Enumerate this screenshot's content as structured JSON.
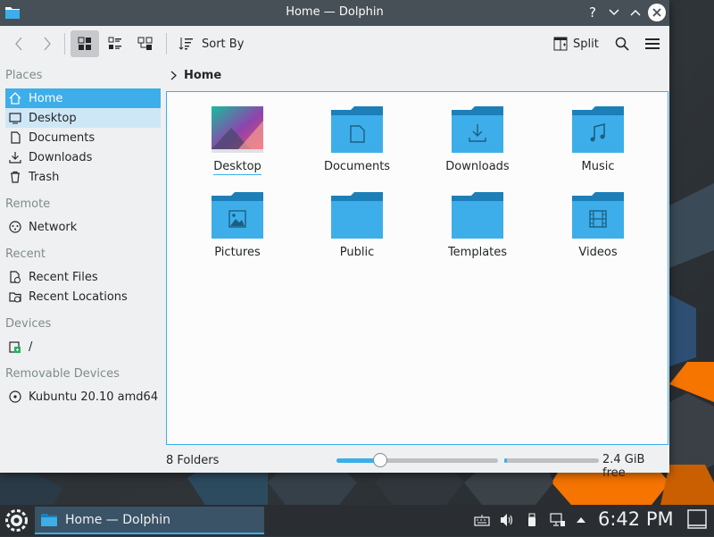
{
  "window": {
    "title": "Home — Dolphin",
    "help_icon": "?",
    "minimize_icon": "⌄",
    "maximize_icon": "⌃",
    "close_icon": "✕"
  },
  "toolbar": {
    "sort_label": "Sort By",
    "split_label": "Split",
    "view_mode_active": "icons"
  },
  "sidebar": {
    "places_header": "Places",
    "places": [
      {
        "label": "Home",
        "icon": "home-icon"
      },
      {
        "label": "Desktop",
        "icon": "desktop-icon"
      },
      {
        "label": "Documents",
        "icon": "document-icon"
      },
      {
        "label": "Downloads",
        "icon": "download-icon"
      },
      {
        "label": "Trash",
        "icon": "trash-icon"
      }
    ],
    "remote_header": "Remote",
    "remote": [
      {
        "label": "Network",
        "icon": "network-icon"
      }
    ],
    "recent_header": "Recent",
    "recent": [
      {
        "label": "Recent Files",
        "icon": "recent-files-icon"
      },
      {
        "label": "Recent Locations",
        "icon": "recent-locations-icon"
      }
    ],
    "devices_header": "Devices",
    "devices": [
      {
        "label": "/",
        "icon": "drive-icon"
      }
    ],
    "removable_header": "Removable Devices",
    "removable": [
      {
        "label": "Kubuntu 20.10 amd64",
        "icon": "optical-disc-icon"
      }
    ]
  },
  "breadcrumb": {
    "current": "Home"
  },
  "folders": [
    {
      "name": "Desktop",
      "icon": "desktop-thumbnail"
    },
    {
      "name": "Documents",
      "icon": "folder-documents-icon"
    },
    {
      "name": "Downloads",
      "icon": "folder-downloads-icon"
    },
    {
      "name": "Music",
      "icon": "folder-music-icon"
    },
    {
      "name": "Pictures",
      "icon": "folder-pictures-icon"
    },
    {
      "name": "Public",
      "icon": "folder-public-icon"
    },
    {
      "name": "Templates",
      "icon": "folder-templates-icon"
    },
    {
      "name": "Videos",
      "icon": "folder-videos-icon"
    }
  ],
  "status": {
    "summary": "8 Folders",
    "free_space": "2.4 GiB free",
    "zoom_fraction": 0.27,
    "space_used_fraction": 0.03
  },
  "taskbar": {
    "task_title": "Home — Dolphin",
    "clock": "6:42 PM"
  },
  "colors": {
    "accent": "#3daee9",
    "folder_body": "#3daee9",
    "folder_tab": "#1d7fb8",
    "titlebar": "#475057",
    "taskbar": "#2a2e32"
  }
}
